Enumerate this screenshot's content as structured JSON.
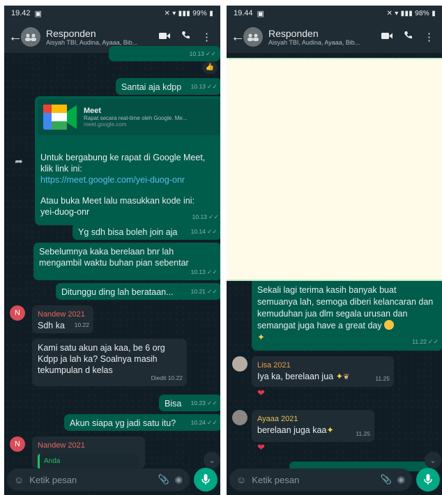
{
  "left": {
    "status": {
      "time": "19.42",
      "right": "99%"
    },
    "header": {
      "title": "Responden",
      "subtitle": "Aisyah TBI, Audina, Ayaaa, Bib..."
    },
    "messages": {
      "m0_time": "10.13",
      "m1_text": "Santai aja kdpp",
      "m1_time": "10.13",
      "meet_title": "Meet",
      "meet_desc": "Rapat secara real-time oleh Google. Me...",
      "meet_url": "meet.google.com",
      "meet_text1": "Untuk bergabung ke rapat di Google Meet, klik link ini:",
      "meet_link": "https://meet.google.com/yei-duog-onr",
      "meet_text2": "Atau buka Meet lalu masukkan kode ini:",
      "meet_code": "yei-duog-onr",
      "meet_time": "10.13",
      "m3_text": "Yg sdh bisa boleh join aja",
      "m3_time": "10.14",
      "m4_text": "Sebelumnya kaka berelaan bnr lah mengambil waktu buhan pian sebentar",
      "m4_time": "10.13",
      "m5_text": "Ditunggu ding lah berataan...",
      "m5_time": "10.21",
      "m6_name": "Nandew 2021",
      "m6_text": "Sdh ka",
      "m6_time": "10.22",
      "m7_text": "Kami satu akun aja kaa, be 6 org Kdpp ja lah ka? Soalnya masih tekumpulan d kelas",
      "m7_time": "Diedit 10.22",
      "m8_text": "Bisa",
      "m8_time": "10.23",
      "m9_text": "Akun siapa yg jadi satu itu?",
      "m9_time": "10.24",
      "m10_name": "Nandew 2021",
      "m10_quote": "Anda"
    },
    "input": {
      "placeholder": "Ketik pesan"
    }
  },
  "right": {
    "status": {
      "time": "19.44",
      "right": "98%"
    },
    "header": {
      "title": "Responden",
      "subtitle": "Aisyah TBI, Audina, Ayaaa, Bib..."
    },
    "messages": {
      "r1_text": "Sekali lagi terima kasih banyak buat semuanya lah, semoga diberi kelancaran dan kemuduhan jua dlm segala urusan dan semangat juga have a great day",
      "r1_time": "11.22",
      "r2_name": "Lisa 2021",
      "r2_text": "Iya ka, berelaan jua",
      "r2_time": "11.25",
      "r3_name": "Ayaaa 2021",
      "r3_text": "berelaan juga kaa",
      "r3_time": "11.25"
    },
    "input": {
      "placeholder": "Ketik pesan"
    }
  },
  "colors": {
    "outgoing": "#005c4b",
    "incoming": "#1f2c34",
    "accent": "#00a884",
    "link": "#53bdeb"
  }
}
